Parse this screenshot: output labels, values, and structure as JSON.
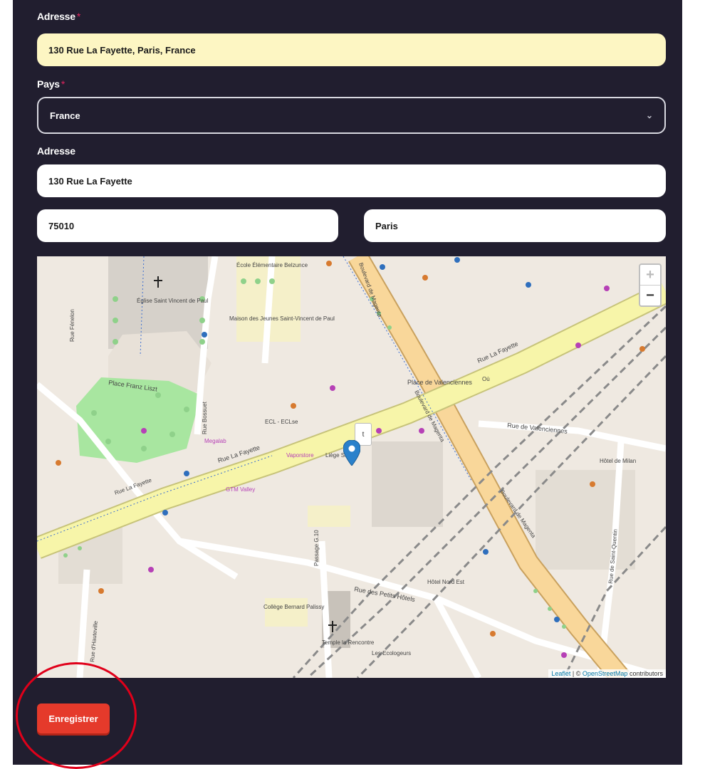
{
  "form": {
    "autocomplete_label": "Adresse",
    "autocomplete_value": "130 Rue La Fayette, Paris, France",
    "country_label": "Pays",
    "country_value": "France",
    "country_caret": "⌄",
    "address_label": "Adresse",
    "address_value": "130 Rue La Fayette",
    "postal_code_value": "75010",
    "city_value": "Paris",
    "required_mark": "*",
    "save_label": "Enregistrer"
  },
  "map": {
    "zoom_in": "+",
    "zoom_out": "−",
    "attribution_leaflet": "Leaflet",
    "attribution_osm": "OpenStreetMap",
    "attribution_suffix": "contributors",
    "popup_text": "t",
    "labels": {
      "church": "Église Saint Vincent de Paul",
      "place_liszt": "Place Franz Liszt",
      "rue_lafayette_1": "Rue La Fayette",
      "rue_lafayette_2": "Rue La Fayette",
      "rue_lafayette_3": "Rue La Fayette",
      "rue_valenciennes": "Rue de Valenciennes",
      "place_valenciennes": "Place de Valenciennes",
      "bd_magenta_1": "Boulevard de Magenta",
      "bd_magenta_2": "Boulevard de Magenta",
      "bd_magenta_3": "Boulevard de Magenta",
      "petits_hotels": "Rue des Petits Hôtels",
      "passage": "Passage G.10",
      "college": "Collège Bernard Palissy",
      "temple": "Temple la Rencontre",
      "maison": "Maison des Jeunes Saint-Vincent de Paul",
      "ecole": "École Élémentaire Belzunce",
      "rue_fenelon": "Rue Fénelon",
      "rue_bossuet": "Rue Bossuet",
      "rue_hauteville": "Rue d'Hauteville",
      "bd_saint_quentin": "Rue de Saint-Quentin",
      "hotel_nord": "Hôtel Nord Est",
      "ecl": "ECL - ECLse",
      "vaporstore": "Vaporstore",
      "gtm": "GTM Valley",
      "megalab": "Megalab",
      "ecologeurs": "Les Ecologeurs",
      "hotel_milan": "Hôtel de Milan",
      "ou": "Où",
      "leye": "Liège Store"
    }
  },
  "colors": {
    "panel_bg": "#211e2f",
    "autocomplete_bg": "#fdf6c3",
    "save_button": "#e53a2b",
    "annotation_circle": "#e0001a",
    "marker": "#2a81cb",
    "road_major": "#f9d79a",
    "road_main": "#f7f5a9"
  },
  "icons": {
    "caret": "chevron-down-icon",
    "marker": "map-marker-icon"
  }
}
